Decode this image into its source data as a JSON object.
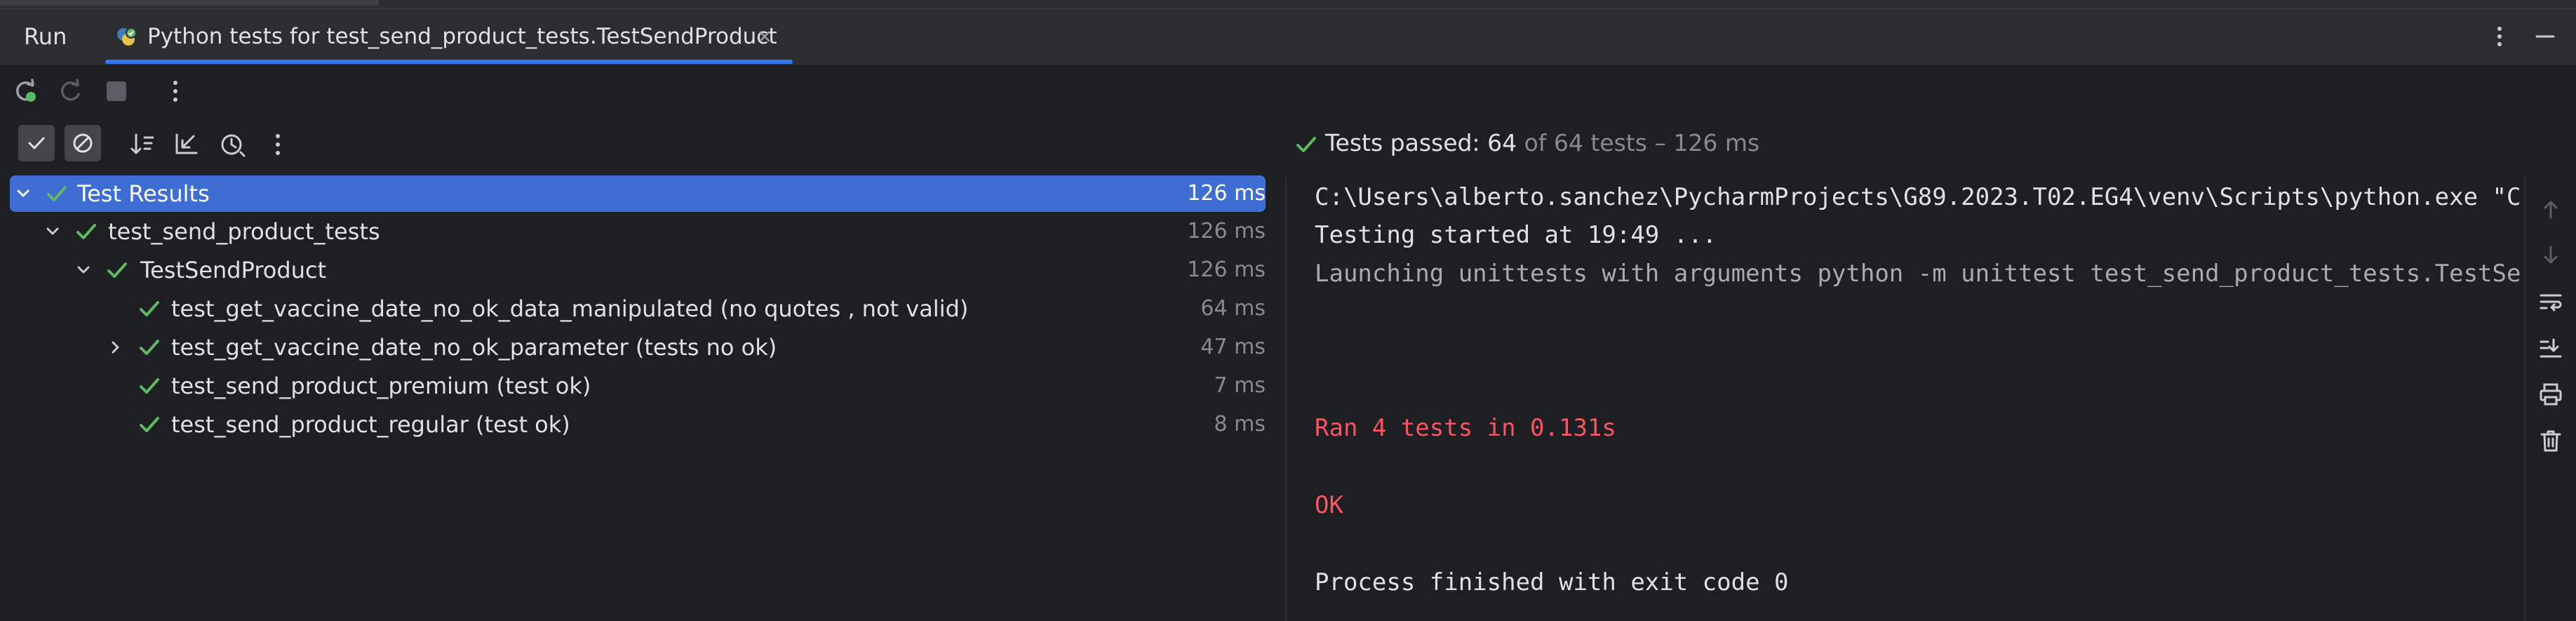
{
  "tabbar": {
    "run_label": "Run",
    "tab_title": "Python tests for test_send_product_tests.TestSendProduct",
    "accent": "#3574f0"
  },
  "runbar": {
    "icons": [
      "rerun-icon",
      "rerun-failed-icon",
      "stop-icon",
      "more-vertical-icon"
    ]
  },
  "treebar": {
    "icons": [
      "show-passed-icon",
      "show-ignored-icon",
      "sort-icon",
      "collapse-icon",
      "history-icon",
      "more-vertical-icon"
    ]
  },
  "status": {
    "passed_text": "Tests passed: 64",
    "suffix_text": "of 64 tests – 126 ms",
    "passed_color": "#5fb865"
  },
  "tree": {
    "rows": [
      {
        "label": "Test Results",
        "time": "126 ms"
      },
      {
        "label": "test_send_product_tests",
        "time": "126 ms"
      },
      {
        "label": "TestSendProduct",
        "time": "126 ms"
      },
      {
        "label": "test_get_vaccine_date_no_ok_data_manipulated (no quotes , not valid)",
        "time": "64 ms"
      },
      {
        "label": "test_get_vaccine_date_no_ok_parameter (tests no ok)",
        "time": "47 ms"
      },
      {
        "label": "test_send_product_premium (test ok)",
        "time": "7 ms"
      },
      {
        "label": "test_send_product_regular (test ok)",
        "time": "8 ms"
      }
    ]
  },
  "console": {
    "lines": [
      "C:\\Users\\alberto.sanchez\\PycharmProjects\\G89.2023.T02.EG4\\venv\\Scripts\\python.exe \"C:/U",
      "Testing started at 19:49 ...",
      "Launching unittests with arguments python -m unittest test_send_product_tests.TestSendPr",
      "Ran 4 tests in 0.131s",
      "OK",
      "Process finished with exit code 0"
    ]
  },
  "rightrail": {
    "icons": [
      "arrow-up-icon",
      "arrow-down-icon",
      "soft-wrap-icon",
      "scroll-to-end-icon",
      "print-icon",
      "trash-icon"
    ]
  }
}
